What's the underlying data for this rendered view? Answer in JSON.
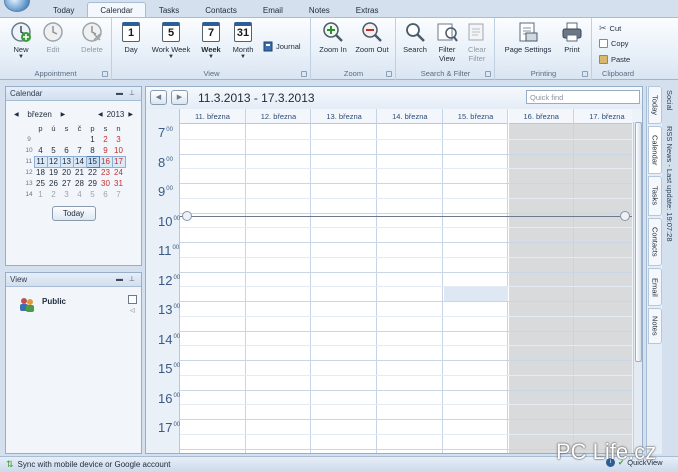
{
  "tabs": [
    "Today",
    "Calendar",
    "Tasks",
    "Contacts",
    "Email",
    "Notes",
    "Extras"
  ],
  "ribbon": {
    "appointment": {
      "label": "Appointment",
      "new": "New",
      "edit": "Edit",
      "delete": "Delete"
    },
    "view": {
      "label": "View",
      "day": "Day",
      "day_num": "1",
      "work_week": "Work Week",
      "work_week_num": "5",
      "week": "Week",
      "week_num": "7",
      "month": "Month",
      "month_num": "31",
      "journal": "Journal"
    },
    "zoom": {
      "label": "Zoom",
      "zoom_in": "Zoom In",
      "zoom_out": "Zoom Out"
    },
    "search_filter": {
      "label": "Search & Filter",
      "search": "Search",
      "filter_view_1": "Filter",
      "filter_view_2": "View",
      "clear_filter_1": "Clear",
      "clear_filter_2": "Filter"
    },
    "printing": {
      "label": "Printing",
      "page_settings": "Page Settings",
      "print": "Print"
    },
    "clipboard": {
      "label": "Clipboard",
      "cut": "Cut",
      "copy": "Copy",
      "paste": "Paste"
    }
  },
  "calendar_panel": {
    "title": "Calendar",
    "month": "březen",
    "year": "2013",
    "weekday_headers": [
      "p",
      "ú",
      "s",
      "č",
      "p",
      "s",
      "n"
    ],
    "weeks": [
      {
        "wk": "9",
        "days": [
          "",
          "",
          "",
          "",
          "1",
          "2",
          "3"
        ]
      },
      {
        "wk": "10",
        "days": [
          "4",
          "5",
          "6",
          "7",
          "8",
          "9",
          "10"
        ]
      },
      {
        "wk": "11",
        "days": [
          "11",
          "12",
          "13",
          "14",
          "15",
          "16",
          "17"
        ]
      },
      {
        "wk": "12",
        "days": [
          "18",
          "19",
          "20",
          "21",
          "22",
          "23",
          "24"
        ]
      },
      {
        "wk": "13",
        "days": [
          "25",
          "26",
          "27",
          "28",
          "29",
          "30",
          "31"
        ]
      },
      {
        "wk": "14",
        "days": [
          "1",
          "2",
          "3",
          "4",
          "5",
          "6",
          "7"
        ]
      }
    ],
    "today_button": "Today"
  },
  "view_panel": {
    "title": "View",
    "public": "Public"
  },
  "main": {
    "range": "11.3.2013 - 17.3.2013",
    "quick_find_placeholder": "Quick find",
    "day_headers": [
      "11. března",
      "12. března",
      "13. března",
      "14. března",
      "15. března",
      "16. března",
      "17. března"
    ],
    "hours": [
      "7",
      "8",
      "9",
      "10",
      "11",
      "12",
      "13",
      "14",
      "15",
      "16",
      "17"
    ],
    "minutes": "00"
  },
  "side_tabs": [
    "Today",
    "Calendar",
    "Tasks",
    "Contacts",
    "Email",
    "Notes"
  ],
  "side_info": {
    "social": "Social",
    "rss": "RSS News - Last update: 19:07:28"
  },
  "status": {
    "sync": "Sync with mobile device or Google account",
    "quickview": "QuickView"
  },
  "watermark": "PC Life.cz",
  "colors": {
    "accent": "#2d5e96",
    "weekend": "#d9dadb",
    "today_border": "#4f7fb3",
    "sunday_red": "#c33030"
  }
}
